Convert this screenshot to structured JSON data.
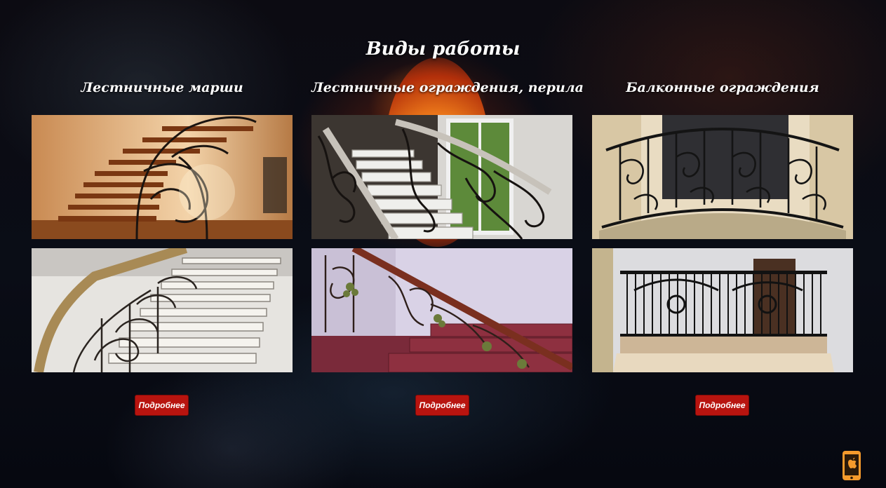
{
  "section": {
    "title": "Виды работы"
  },
  "columns": [
    {
      "title": "Лестничные марши",
      "button_label": "Подробнее",
      "photos": [
        "spiral-staircase-photo",
        "staircase-railing-photo"
      ]
    },
    {
      "title": "Лестничные ограждения, перила",
      "button_label": "Подробнее",
      "photos": [
        "stair-railing-window-photo",
        "grape-railing-photo"
      ]
    },
    {
      "title": "Балконные ограждения",
      "button_label": "Подробнее",
      "photos": [
        "curved-balcony-photo",
        "straight-balcony-photo"
      ]
    }
  ],
  "floating": {
    "icon": "mobile-app-icon"
  },
  "colors": {
    "button": "#b8140f",
    "accent_icon": "#f59a2c",
    "text": "#ffffff"
  }
}
